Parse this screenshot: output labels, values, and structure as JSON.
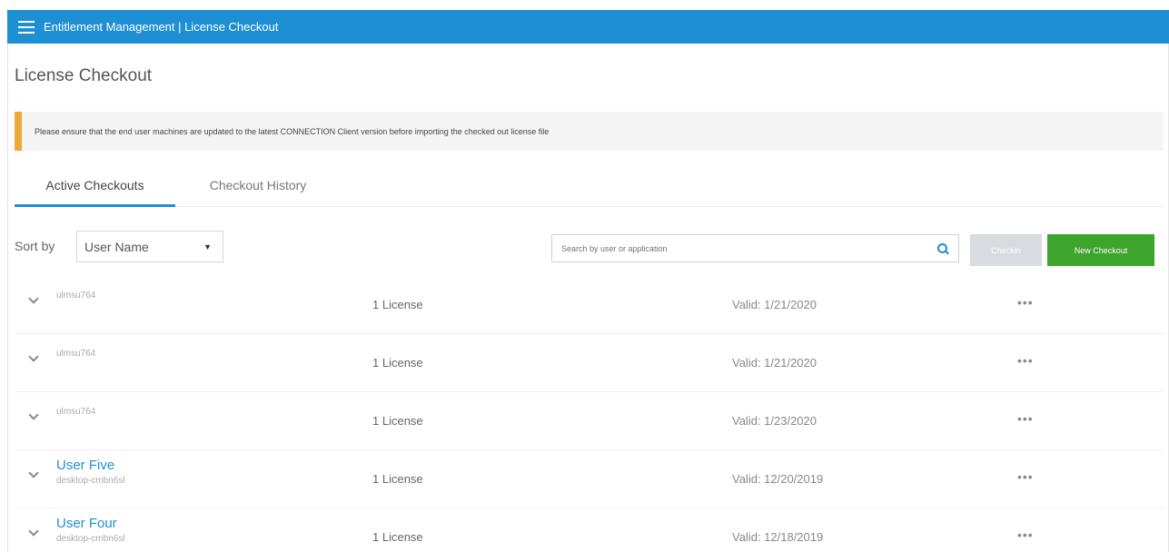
{
  "header": {
    "title": "Entitlement Management | License Checkout",
    "menu_icon": "hamburger-menu-icon",
    "bar_color": "#1f8fd3"
  },
  "page": {
    "title": "License Checkout"
  },
  "banner": {
    "text": "Please ensure that the end user machines are updated to the latest CONNECTION Client version before importing the checked out license file",
    "accent_color": "#f0a73a"
  },
  "tabs": [
    {
      "label": "Active Checkouts",
      "active": true
    },
    {
      "label": "Checkout History",
      "active": false
    }
  ],
  "toolbar": {
    "sort_label": "Sort by",
    "sort_value": "User Name",
    "search_placeholder": "Search by user or application",
    "disabled_button_label": "Checkin",
    "new_checkout_label": "New Checkout",
    "new_checkout_color": "#3da42c"
  },
  "rows": [
    {
      "user": "ulmsu764",
      "subtitle": "",
      "license": "1 License",
      "valid": "Valid: 1/21/2020",
      "highlighted": false
    },
    {
      "user": "ulmsu764",
      "subtitle": "",
      "license": "1 License",
      "valid": "Valid: 1/21/2020",
      "highlighted": false
    },
    {
      "user": "ulmsu764",
      "subtitle": "",
      "license": "1 License",
      "valid": "Valid: 1/23/2020",
      "highlighted": false
    },
    {
      "user": "User Five",
      "subtitle": "desktop-cmbn6sl",
      "license": "1 License",
      "valid": "Valid: 12/20/2019",
      "highlighted": true
    },
    {
      "user": "User Four",
      "subtitle": "desktop-cmbn6sl",
      "license": "1 License",
      "valid": "Valid: 12/18/2019",
      "highlighted": true
    }
  ],
  "row_actions_label": "•••"
}
